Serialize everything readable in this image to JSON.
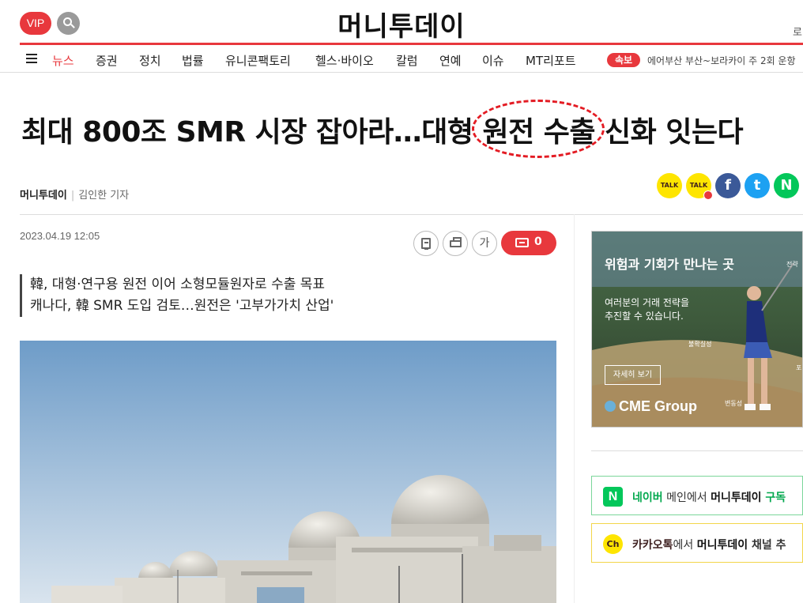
{
  "header": {
    "vip_label": "VIP",
    "logo": "머니투데이",
    "login_partial": "로"
  },
  "nav": {
    "items": [
      {
        "label": "뉴스",
        "active": true
      },
      {
        "label": "증권"
      },
      {
        "label": "정치"
      },
      {
        "label": "법률"
      },
      {
        "label": "유니콘팩토리"
      },
      {
        "label": "헬스·바이오"
      },
      {
        "label": "칼럼"
      },
      {
        "label": "연예"
      },
      {
        "label": "이슈"
      },
      {
        "label": "MT리포트"
      }
    ],
    "breaking_badge": "속보",
    "breaking_text": "에어부산 부산~보라카이 주 2회 운항"
  },
  "article": {
    "title_before": "최대 800조 SMR 시장 잡아라…대형 ",
    "title_circled": "원전 수출",
    "title_after": " 신화 잇는다",
    "press": "머니투데이",
    "reporter": "김인한 기자",
    "date": "2023.04.19 12:05",
    "summary_lines": [
      "韓, 대형·연구용 원전 이어 소형모듈원자로 수출 목표",
      "캐나다, 韓 SMR 도입 검토…원전은 '고부가가치 산업'"
    ],
    "font_btn": "가",
    "comment_count": "0"
  },
  "share": {
    "kakaotalk": "TALK",
    "kakaostory": "TALK",
    "facebook": "f",
    "twitter": "t",
    "naver": "N"
  },
  "ad": {
    "title": "위험과 기회가 만나는 곳",
    "body_line1": "여러분의 거래 전략을",
    "body_line2": "추진할 수 있습니다.",
    "button": "자세히 보기",
    "brand": "CME Group",
    "tag1": "불확실성",
    "tag2": "변동성",
    "tag3": "전략",
    "tag4": "포"
  },
  "subscribe": {
    "naver_icon": "N",
    "naver_hl": "네이버",
    "naver_mid": " 메인에서 ",
    "naver_brand": "머니투데이",
    "naver_action": " 구독",
    "kakao_icon": "Ch",
    "kakao_hl": "카카오톡",
    "kakao_mid": "에서 ",
    "kakao_brand": "머니투데이",
    "kakao_action": " 채널 추"
  },
  "colors": {
    "accent": "#e8383d",
    "circle": "#e31b23",
    "naver": "#03c75a",
    "kakao": "#fee500",
    "facebook": "#3b5998",
    "twitter": "#1da1f2"
  }
}
